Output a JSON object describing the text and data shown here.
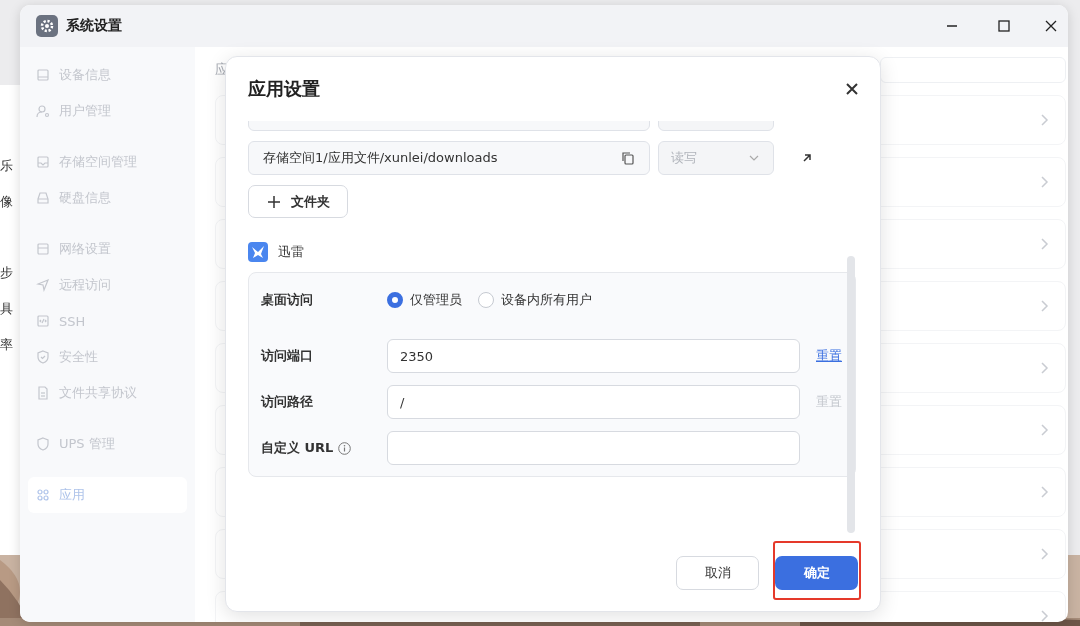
{
  "behind_window": {
    "texts": [
      "乐",
      "像",
      "步",
      "具",
      "率"
    ]
  },
  "window": {
    "title": "系统设置"
  },
  "sidebar": {
    "groups": [
      {
        "items": [
          {
            "label": "设备信息",
            "selected": false
          },
          {
            "label": "用户管理",
            "selected": false
          }
        ]
      },
      {
        "items": [
          {
            "label": "存储空间管理",
            "selected": false
          },
          {
            "label": "硬盘信息",
            "selected": false
          }
        ]
      },
      {
        "items": [
          {
            "label": "网络设置",
            "selected": false
          },
          {
            "label": "远程访问",
            "selected": false
          },
          {
            "label": "SSH",
            "selected": false
          },
          {
            "label": "安全性",
            "selected": false
          },
          {
            "label": "文件共享协议",
            "selected": false
          }
        ]
      },
      {
        "items": [
          {
            "label": "UPS 管理",
            "selected": false
          }
        ]
      },
      {
        "items": [
          {
            "label": "应用",
            "selected": true
          }
        ]
      }
    ]
  },
  "main": {
    "heading": "应"
  },
  "dialog": {
    "title": "应用设置",
    "folders": [
      {
        "path": "存储空间1/应用文件/xunlei/downloads",
        "permission": "读写",
        "permission_disabled": true
      }
    ],
    "add_folder_button": "文件夹",
    "app": {
      "name": "迅雷"
    },
    "access": {
      "label": "桌面访问",
      "options": [
        {
          "label": "仅管理员",
          "selected": true
        },
        {
          "label": "设备内所有用户",
          "selected": false
        }
      ]
    },
    "fields": [
      {
        "label": "访问端口",
        "value": "2350",
        "reset": {
          "label": "重置",
          "disabled": false
        }
      },
      {
        "label": "访问路径",
        "value": "/",
        "reset": {
          "label": "重置",
          "disabled": true
        }
      },
      {
        "label": "自定义 URL",
        "info": true
      }
    ],
    "buttons": [
      {
        "label": "取消",
        "kind": "secondary",
        "highlighted": false
      },
      {
        "label": "确定",
        "kind": "primary",
        "highlighted": true
      }
    ]
  }
}
